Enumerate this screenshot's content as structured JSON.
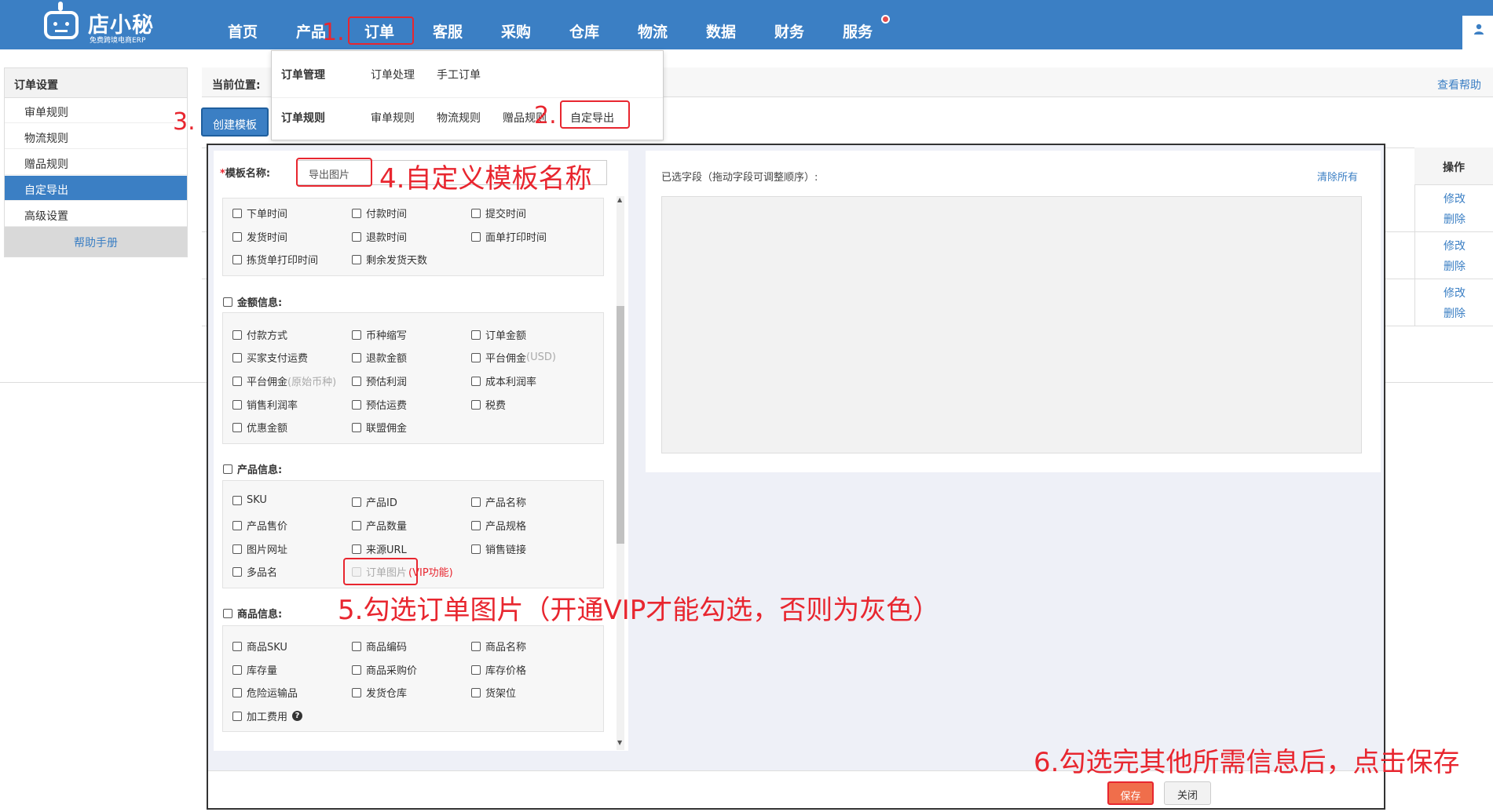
{
  "brand": {
    "name": "店小秘",
    "tagline": "免费跨境电商ERP"
  },
  "nav": [
    "首页",
    "产品",
    "订单",
    "客服",
    "采购",
    "仓库",
    "物流",
    "数据",
    "财务",
    "服务"
  ],
  "annotations": {
    "step1": "1.",
    "step2": "2.",
    "step3": "3.",
    "step4": "4.自定义模板名称",
    "step5": "5.勾选订单图片（开通VIP才能勾选，否则为灰色）",
    "step6": "6.勾选完其他所需信息后，点击保存"
  },
  "sidebar": {
    "title": "订单设置",
    "items": [
      "审单规则",
      "物流规则",
      "赠品规则",
      "自定导出",
      "高级设置"
    ],
    "help": "帮助手册"
  },
  "breadcrumb": {
    "label": "当前位置:"
  },
  "help_link": "查看帮助",
  "create_button": "创建模板",
  "dropdown": {
    "group1": {
      "head": "订单管理",
      "items": [
        "订单处理",
        "手工订单"
      ]
    },
    "group2": {
      "head": "订单规则",
      "items": [
        "审单规则",
        "物流规则",
        "赠品规则",
        "自定导出"
      ]
    }
  },
  "table": {
    "op_header": "操作",
    "edit": "修改",
    "delete": "删除"
  },
  "modal": {
    "template_name_label": "模板名称:",
    "template_name_value": "导出图片",
    "selected_label": "已选字段（拖动字段可调整顺序）:",
    "clear_all": "清除所有",
    "save": "保存",
    "close": "关闭"
  },
  "time_fields": [
    "下单时间",
    "付款时间",
    "提交时间",
    "发货时间",
    "退款时间",
    "面单打印时间",
    "拣货单打印时间",
    "剩余发货天数"
  ],
  "amount": {
    "head": "金额信息:",
    "fields": [
      "付款方式",
      "币种缩写",
      "订单金额",
      "买家支付运费",
      "退款金额",
      "平台佣金",
      "平台佣金",
      "预估利润",
      "成本利润率",
      "销售利润率",
      "预估运费",
      "税费",
      "优惠金额",
      "联盟佣金"
    ],
    "usd_suffix": "(USD)",
    "orig_suffix": "(原始币种)"
  },
  "product": {
    "head": "产品信息:",
    "fields": [
      "SKU",
      "产品ID",
      "产品名称",
      "产品售价",
      "产品数量",
      "产品规格",
      "图片网址",
      "来源URL",
      "销售链接",
      "多品名",
      "订单图片"
    ],
    "vip_suffix": "(VIP功能)"
  },
  "goods": {
    "head": "商品信息:",
    "fields": [
      "商品SKU",
      "商品编码",
      "商品名称",
      "库存量",
      "商品采购价",
      "库存价格",
      "危险运输品",
      "发货仓库",
      "货架位",
      "加工费用"
    ]
  },
  "icons": {
    "user": "user-icon",
    "help": "question-circle-icon",
    "logo": "robot-logo-icon"
  },
  "colors": {
    "primary": "#3b7fc4",
    "annotation": "#e8262f",
    "save": "#f06e4b"
  }
}
